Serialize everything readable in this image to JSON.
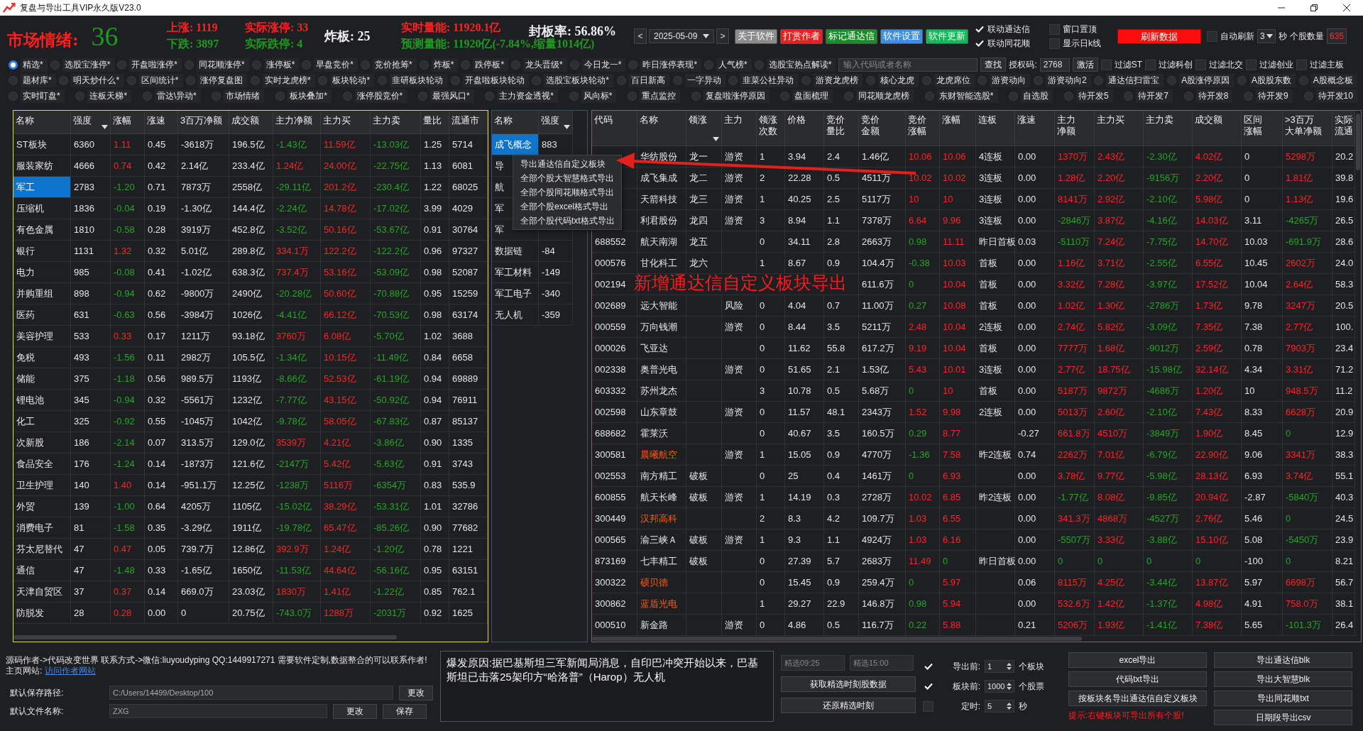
{
  "window": {
    "title": "复盘与导出工具VIP永久版V23.0"
  },
  "mood": {
    "label": "市场情绪:",
    "value": "36"
  },
  "stat_columns": [
    [
      {
        "text": "上涨:  1119",
        "color": "#ff2020"
      },
      {
        "text": "下跌:  3897",
        "color": "#1f9a1f"
      }
    ],
    [
      {
        "text": "实际涨停: 33",
        "color": "#ff2020"
      },
      {
        "text": "实际跌停: 4",
        "color": "#1f9a1f"
      }
    ],
    [
      {
        "text": "炸板:  25",
        "color": "#f0f0f0"
      }
    ],
    [
      {
        "text": "实时量能: 11920.1亿",
        "color": "#ff2020"
      },
      {
        "text": "预测量能: 11920亿(-7.84%,缩量1014亿)",
        "color": "#1f9a1f"
      }
    ],
    [
      {
        "text": "封板率:  56.86%",
        "color": "#f0f0f0"
      }
    ]
  ],
  "date_nav": {
    "prev": "<",
    "date": "2025-05-09",
    "next": ">"
  },
  "top_buttons": [
    {
      "label": "关于软件",
      "color": "#8c8c8c"
    },
    {
      "label": "打赏作者",
      "color": "#e8201e"
    },
    {
      "label": "标记通达信",
      "color": "#1c8c28"
    },
    {
      "label": "软件设置",
      "color": "#3f8fe0"
    },
    {
      "label": "软件更新",
      "color": "#17b85a"
    }
  ],
  "link_options": [
    {
      "label": "联动通达信",
      "checked": true
    },
    {
      "label": "联动同花顺",
      "checked": true
    },
    {
      "label": "窗口置顶",
      "checked": false
    },
    {
      "label": "显示日k线",
      "checked": false
    }
  ],
  "refresh_button": "刷新数据",
  "auto_refresh": {
    "label": "自动刷新",
    "checked": false,
    "interval": "3",
    "unit": "秒"
  },
  "stock_count": {
    "label": "个股数量",
    "value": "635"
  },
  "views": [
    [
      {
        "label": "精选*",
        "selected": true
      },
      {
        "label": "选股宝涨停*",
        "selected": false
      },
      {
        "label": "开盘啦涨停*",
        "selected": false
      },
      {
        "label": "同花顺涨停*",
        "selected": false
      },
      {
        "label": "涨停板*",
        "selected": false
      },
      {
        "label": "早盘竞价*",
        "selected": false
      },
      {
        "label": "竞价抢筹*",
        "selected": false
      },
      {
        "label": "炸板*",
        "selected": false
      },
      {
        "label": "跌停板*",
        "selected": false
      },
      {
        "label": "龙头晋级*",
        "selected": false
      },
      {
        "label": "今日龙一*",
        "selected": false
      },
      {
        "label": "昨日涨停表现*",
        "selected": false
      },
      {
        "label": "人气榜*",
        "selected": false
      },
      {
        "label": "选股宝热点解读*",
        "selected": false
      }
    ],
    [
      {
        "label": "题材库*",
        "selected": false
      },
      {
        "label": "明天炒什么*",
        "selected": false
      },
      {
        "label": "区间统计*",
        "selected": false
      },
      {
        "label": "涨停复盘图",
        "selected": false
      },
      {
        "label": "实时龙虎榜*",
        "selected": false
      },
      {
        "label": "板块轮动*",
        "selected": false
      },
      {
        "label": "韭研板块轮动",
        "selected": false
      },
      {
        "label": "开盘啦板块轮动",
        "selected": false
      },
      {
        "label": "选股宝板块轮动*",
        "selected": false
      },
      {
        "label": "百日新高",
        "selected": false
      },
      {
        "label": "一字异动",
        "selected": false
      },
      {
        "label": "韭菜公社异动",
        "selected": false
      },
      {
        "label": "游资龙虎榜",
        "selected": false
      },
      {
        "label": "核心龙虎",
        "selected": false
      },
      {
        "label": "龙虎席位",
        "selected": false
      },
      {
        "label": "游资动向",
        "selected": false
      },
      {
        "label": "游资动向2",
        "selected": false
      },
      {
        "label": "通达信扫雷宝",
        "selected": false
      },
      {
        "label": "A股涨停原因",
        "selected": false
      },
      {
        "label": "A股股东数",
        "selected": false
      },
      {
        "label": "A股概念板",
        "selected": false
      }
    ],
    [
      {
        "label": "实时盯盘*",
        "selected": false
      },
      {
        "label": "连板天梯*",
        "selected": false
      },
      {
        "label": "雷达\\异动*",
        "selected": false
      },
      {
        "label": "市场情绪",
        "selected": false
      },
      {
        "label": "板块叠加*",
        "selected": false
      },
      {
        "label": "涨停股竞价*",
        "selected": false
      },
      {
        "label": "最强风口*",
        "selected": false
      },
      {
        "label": "主力资金透视*",
        "selected": false
      },
      {
        "label": "风向标*",
        "selected": false
      },
      {
        "label": "重点监控",
        "selected": false
      },
      {
        "label": "复盘啦涨停原因",
        "selected": false
      },
      {
        "label": "盘面梳理",
        "selected": false
      },
      {
        "label": "同花顺龙虎榜",
        "selected": false
      },
      {
        "label": "东财智能选股*",
        "selected": false
      },
      {
        "label": "自选股",
        "selected": false
      },
      {
        "label": "待开发5",
        "selected": false
      },
      {
        "label": "待开发7",
        "selected": false
      },
      {
        "label": "待开发8",
        "selected": false
      },
      {
        "label": "待开发9",
        "selected": false
      },
      {
        "label": "待开发10",
        "selected": false
      }
    ]
  ],
  "search": {
    "placeholder": "输入代码或者名称",
    "button": "查找"
  },
  "auth": {
    "label": "授权码:",
    "value": "2768",
    "button": "激活"
  },
  "filters": [
    {
      "label": "过滤ST",
      "checked": false
    },
    {
      "label": "过滤科创",
      "checked": false
    },
    {
      "label": "过滤北交",
      "checked": false
    },
    {
      "label": "过滤创业",
      "checked": false
    },
    {
      "label": "过滤主板",
      "checked": false
    }
  ],
  "sector_table": {
    "columns": [
      {
        "label": "名称",
        "kind": "plain",
        "sorted": false
      },
      {
        "label": "强度",
        "kind": "plain",
        "sorted": true
      },
      {
        "label": "涨幅",
        "kind": "signed",
        "sorted": false
      },
      {
        "label": "涨速",
        "kind": "plain",
        "sorted": false
      },
      {
        "label": "3百万净额",
        "kind": "plain",
        "sorted": false
      },
      {
        "label": "成交额",
        "kind": "plain",
        "sorted": false
      },
      {
        "label": "主力净额",
        "kind": "signed",
        "sorted": false
      },
      {
        "label": "主力买",
        "kind": "signed",
        "sorted": false
      },
      {
        "label": "主力卖",
        "kind": "signed",
        "sorted": false
      },
      {
        "label": "量比",
        "kind": "plain",
        "sorted": false
      },
      {
        "label": "流通市",
        "kind": "plain",
        "sorted": false
      }
    ],
    "rows": [
      {
        "cells": [
          "ST板块",
          "6360",
          "1.11",
          "0.45",
          "-3618万",
          "196.5亿",
          "-1.43亿",
          "11.59亿",
          "-13.03亿",
          "1.25",
          "5714"
        ],
        "selected": false
      },
      {
        "cells": [
          "服装家纺",
          "4666",
          "0.74",
          "0.42",
          "2.14亿",
          "233.4亿",
          "1.24亿",
          "24.00亿",
          "-22.75亿",
          "1.13",
          "6081"
        ],
        "selected": false
      },
      {
        "cells": [
          "军工",
          "2783",
          "-1.20",
          "0.71",
          "7873万",
          "2558亿",
          "-29.11亿",
          "201.2亿",
          "-230.4亿",
          "1.22",
          "68025"
        ],
        "selected": true
      },
      {
        "cells": [
          "压缩机",
          "1836",
          "-0.04",
          "0.19",
          "-1.30亿",
          "144.4亿",
          "-2.24亿",
          "14.78亿",
          "-17.02亿",
          "3.99",
          "4029"
        ],
        "selected": false
      },
      {
        "cells": [
          "有色金属",
          "1810",
          "-0.58",
          "0.28",
          "3919万",
          "452.8亿",
          "-3.52亿",
          "50.16亿",
          "-53.67亿",
          "0.91",
          "30764"
        ],
        "selected": false
      },
      {
        "cells": [
          "银行",
          "1131",
          "1.32",
          "0.32",
          "5.01亿",
          "289.8亿",
          "334.1万",
          "122.2亿",
          "-122.2亿",
          "0.96",
          "97327"
        ],
        "selected": false
      },
      {
        "cells": [
          "电力",
          "985",
          "-0.08",
          "0.41",
          "-1.02亿",
          "638.3亿",
          "737.4万",
          "53.16亿",
          "-53.09亿",
          "0.98",
          "52087"
        ],
        "selected": false
      },
      {
        "cells": [
          "并购重组",
          "898",
          "-0.94",
          "0.62",
          "-9800万",
          "2490亿",
          "-20.28亿",
          "50.60亿",
          "-70.88亿",
          "0.95",
          "15259"
        ],
        "selected": false
      },
      {
        "cells": [
          "医药",
          "631",
          "-0.63",
          "0.56",
          "-3984万",
          "1026亿",
          "-4.41亿",
          "66.12亿",
          "-70.53亿",
          "0.98",
          "63174"
        ],
        "selected": false
      },
      {
        "cells": [
          "美容护理",
          "533",
          "0.33",
          "0.17",
          "1211万",
          "93.18亿",
          "3760万",
          "6.08亿",
          "-5.70亿",
          "1.02",
          "3688"
        ],
        "selected": false
      },
      {
        "cells": [
          "免税",
          "493",
          "-1.56",
          "0.11",
          "2982万",
          "105.5亿",
          "-1.34亿",
          "10.15亿",
          "-11.49亿",
          "0.84",
          "6658"
        ],
        "selected": false
      },
      {
        "cells": [
          "储能",
          "375",
          "-1.18",
          "0.56",
          "989.5万",
          "1193亿",
          "-8.66亿",
          "52.53亿",
          "-61.19亿",
          "0.94",
          "69889"
        ],
        "selected": false
      },
      {
        "cells": [
          "锂电池",
          "345",
          "-0.94",
          "0.32",
          "-5561万",
          "1232亿",
          "-7.77亿",
          "43.15亿",
          "-50.92亿",
          "0.94",
          "76911"
        ],
        "selected": false
      },
      {
        "cells": [
          "化工",
          "325",
          "-0.92",
          "0.55",
          "-1045万",
          "1042亿",
          "-9.78亿",
          "58.05亿",
          "-67.83亿",
          "0.87",
          "85137"
        ],
        "selected": false
      },
      {
        "cells": [
          "次新股",
          "186",
          "-2.14",
          "0.07",
          "313.5万",
          "129.0亿",
          "3539万",
          "4.21亿",
          "-3.86亿",
          "0.90",
          "1335"
        ],
        "selected": false
      },
      {
        "cells": [
          "食品安全",
          "176",
          "-1.24",
          "0.14",
          "-1873万",
          "121.6亿",
          "-2147万",
          "5.42亿",
          "-5.63亿",
          "0.91",
          "3743"
        ],
        "selected": false
      },
      {
        "cells": [
          "卫生护理",
          "140",
          "1.40",
          "0.14",
          "-951.1万",
          "12.25亿",
          "-1238万",
          "5116万",
          "-6354万",
          "0.83",
          "535.9"
        ],
        "selected": false
      },
      {
        "cells": [
          "外贸",
          "139",
          "-1.00",
          "0.64",
          "4205万",
          "1105亿",
          "-15.02亿",
          "38.29亿",
          "-53.31亿",
          "1.01",
          "32786"
        ],
        "selected": false
      },
      {
        "cells": [
          "消费电子",
          "81",
          "-1.58",
          "0.35",
          "-3.29亿",
          "1911亿",
          "-19.78亿",
          "65.47亿",
          "-85.26亿",
          "0.90",
          "77682"
        ],
        "selected": false
      },
      {
        "cells": [
          "芬太尼替代",
          "47",
          "0.47",
          "0.05",
          "739.7万",
          "12.86亿",
          "392.9万",
          "1.24亿",
          "-1.20亿",
          "0.78",
          "1221"
        ],
        "selected": false
      },
      {
        "cells": [
          "通信",
          "47",
          "-1.48",
          "0.33",
          "-1.65亿",
          "1650亿",
          "-11.53亿",
          "44.64亿",
          "-56.16亿",
          "0.95",
          "63151"
        ],
        "selected": false
      },
      {
        "cells": [
          "天津自贸区",
          "37",
          "0.37",
          "0.14",
          "669.0万",
          "23.03亿",
          "1830万",
          "1.41亿",
          "-1.22亿",
          "0.85",
          "762.1"
        ],
        "selected": false
      },
      {
        "cells": [
          "防脱发",
          "28",
          "0.28",
          "0.00",
          "0",
          "20.75亿",
          "-743.0万",
          "1288万",
          "-2031万",
          "0.92",
          "1625"
        ],
        "selected": false
      }
    ]
  },
  "concept_table": {
    "columns": [
      {
        "label": "名称",
        "sorted": false
      },
      {
        "label": "强度",
        "sorted": true
      }
    ],
    "rows": [
      {
        "cells": [
          "成飞概念",
          "883"
        ],
        "selected": true
      },
      {
        "cells": [
          "导",
          null
        ],
        "selected": false
      },
      {
        "cells": [
          "航",
          null
        ],
        "selected": false
      },
      {
        "cells": [
          "军",
          null
        ],
        "selected": false
      },
      {
        "cells": [
          "军",
          null
        ],
        "selected": false
      },
      {
        "cells": [
          "数据链",
          "-84"
        ],
        "selected": false
      },
      {
        "cells": [
          "军工材料",
          "-149"
        ],
        "selected": false
      },
      {
        "cells": [
          "军工电子",
          "-340"
        ],
        "selected": false
      },
      {
        "cells": [
          "无人机",
          "-359"
        ],
        "selected": false
      }
    ]
  },
  "context_menu": {
    "items": [
      "导出通达信自定义板块",
      "全部个股大智慧格式导出",
      "全部个股同花顺格式导出",
      "全部个股excel格式导出",
      "全部个股代码txt格式导出"
    ]
  },
  "stock_table": {
    "columns": [
      {
        "lines": [
          "代码"
        ],
        "kind": "plain",
        "sorted": false
      },
      {
        "lines": [
          "名称"
        ],
        "kind": "name",
        "sorted": false
      },
      {
        "lines": [
          "领涨"
        ],
        "kind": "plain",
        "sorted": true
      },
      {
        "lines": [
          "主力"
        ],
        "kind": "plain",
        "sorted": false
      },
      {
        "lines": [
          "领涨",
          "次数"
        ],
        "kind": "plain",
        "sorted": false
      },
      {
        "lines": [
          "价格"
        ],
        "kind": "plain",
        "sorted": false
      },
      {
        "lines": [
          "竞价",
          "量比"
        ],
        "kind": "plain",
        "sorted": false
      },
      {
        "lines": [
          "竞价",
          "金额"
        ],
        "kind": "plain",
        "sorted": false
      },
      {
        "lines": [
          "竞价",
          "涨幅"
        ],
        "kind": "auction",
        "sorted": false
      },
      {
        "lines": [
          "涨幅"
        ],
        "kind": "signed",
        "sorted": false
      },
      {
        "lines": [
          "连板"
        ],
        "kind": "plain",
        "sorted": false
      },
      {
        "lines": [
          "涨速"
        ],
        "kind": "plain",
        "sorted": false
      },
      {
        "lines": [
          "主力",
          "净额"
        ],
        "kind": "signed",
        "sorted": false
      },
      {
        "lines": [
          "主力买"
        ],
        "kind": "signed",
        "sorted": false
      },
      {
        "lines": [
          "主力卖"
        ],
        "kind": "signed",
        "sorted": false
      },
      {
        "lines": [
          "成交额"
        ],
        "kind": "signed",
        "sorted": false
      },
      {
        "lines": [
          "区间",
          "涨幅"
        ],
        "kind": "plain",
        "sorted": false
      },
      {
        "lines": [
          ">3百万",
          "大单净额"
        ],
        "kind": "signed",
        "sorted": false
      },
      {
        "lines": [
          "实际",
          "流通"
        ],
        "kind": "plain",
        "sorted": false
      }
    ],
    "rows": [
      {
        "cells": [
          null,
          "华纺股份",
          "龙一",
          "游资",
          "1",
          "3.94",
          "2.4",
          "1.46亿",
          "10.06",
          "10.06",
          "4连板",
          "0.00",
          "1370万",
          "2.43亿",
          "-2.30亿",
          "4.02亿",
          "0",
          "5298万",
          "20.2"
        ],
        "highlight": false
      },
      {
        "cells": [
          null,
          "成飞集成",
          "龙二",
          "游资",
          "2",
          "22.28",
          "0.5",
          "4511万",
          "10.02",
          "10.02",
          "3连板",
          "0.00",
          "1.28亿",
          "2.20亿",
          "-9156万",
          "2.20亿",
          "0",
          "1.81亿",
          "39.8"
        ],
        "highlight": false
      },
      {
        "cells": [
          null,
          "天箭科技",
          "龙三",
          "游资",
          "1",
          "40.25",
          "2.5",
          "5117万",
          "10",
          "10",
          "3连板",
          "0.00",
          "8141万",
          "2.92亿",
          "-2.10亿",
          "5.98亿",
          "0",
          "1.13亿",
          "19.6"
        ],
        "highlight": false
      },
      {
        "cells": [
          null,
          "利君股份",
          "龙四",
          "游资",
          "3",
          "8.94",
          "1.1",
          "7378万",
          "6.64",
          "9.96",
          "3连板",
          "0.00",
          "-2846万",
          "3.87亿",
          "-4.16亿",
          "14.03亿",
          "3.11",
          "-4265万",
          "26.5"
        ],
        "highlight": false
      },
      {
        "cells": [
          "688552",
          "航天南湖",
          "龙五",
          null,
          "0",
          "34.11",
          "2.8",
          "2663万",
          "0.98",
          "11.11",
          "昨日首板",
          "0.03",
          "-5110万",
          "7.24亿",
          "-7.75亿",
          "14.70亿",
          "10.03",
          "-691.9万",
          "28.6"
        ],
        "highlight": false
      },
      {
        "cells": [
          "000576",
          "甘化科工",
          "龙六",
          null,
          "1",
          "8.67",
          "0.9",
          "104.4万",
          "-0.38",
          "10.03",
          "首板",
          "0.00",
          "1.16亿",
          "3.71亿",
          "-2.55亿",
          "6.55亿",
          "10.45",
          "2602万",
          "24.0"
        ],
        "highlight": false
      },
      {
        "cells": [
          "002194",
          null,
          null,
          null,
          null,
          null,
          null,
          "611.6万",
          "0",
          "10.04",
          "首板",
          "0.00",
          "3.32亿",
          "7.28亿",
          "-3.97亿",
          "17.52亿",
          "10.04",
          "2.64亿",
          "58.3"
        ]
      },
      {
        "cells": [
          "002689",
          "远大智能",
          null,
          "风险",
          "0",
          "4.04",
          "0.7",
          "11.00万",
          "0.27",
          "10.08",
          "首板",
          "0.00",
          "1.02亿",
          "1.30亿",
          "-2786万",
          "1.73亿",
          "9.78",
          "3247万",
          "20.5"
        ],
        "highlight": false
      },
      {
        "cells": [
          "000559",
          "万向钱潮",
          null,
          "游资",
          "0",
          "8.44",
          "3.5",
          "5211万",
          "2.48",
          "10.04",
          "2连板",
          "0.00",
          "2.74亿",
          "5.82亿",
          "-3.09亿",
          "7.35亿",
          "7.38",
          "2.77亿",
          "100."
        ],
        "highlight": false
      },
      {
        "cells": [
          "000026",
          "飞亚达",
          null,
          null,
          "0",
          "11.62",
          "55.8",
          "617.2万",
          "9.19",
          "10.04",
          "首板",
          "0.00",
          "7777万",
          "1.68亿",
          "-9012万",
          "2.59亿",
          "0.78",
          "7903万",
          "23.4"
        ],
        "highlight": false
      },
      {
        "cells": [
          "002338",
          "奥普光电",
          null,
          "游资",
          "0",
          "51.65",
          "2.1",
          "1.53亿",
          "5.43",
          "10.01",
          "3连板",
          "0.00",
          "2.77亿",
          "18.75亿",
          "-15.98亿",
          "32.14亿",
          "4.34",
          "3.31亿",
          "71.2"
        ],
        "highlight": false
      },
      {
        "cells": [
          "603332",
          "苏州龙杰",
          null,
          null,
          "3",
          "10.78",
          "0.5",
          "5.68万",
          "0",
          "10",
          "首板",
          "0.00",
          "5187万",
          "9872万",
          "-4686万",
          "1.20亿",
          "10",
          "948.5万",
          "11.2"
        ],
        "highlight": false
      },
      {
        "cells": [
          "002598",
          "山东章鼓",
          null,
          "游资",
          "0",
          "11.57",
          "48.1",
          "2343万",
          "1.52",
          "9.98",
          "2连板",
          "0.00",
          "5013万",
          "2.60亿",
          "-2.10亿",
          "7.43亿",
          "8.33",
          "6628万",
          "20.9"
        ],
        "highlight": false
      },
      {
        "cells": [
          "688682",
          "霍莱沃",
          null,
          null,
          "0",
          "40.67",
          "3.5",
          "160.5万",
          "0.29",
          "8.77",
          null,
          "-0.27",
          "661.8万",
          "4510万",
          "-3849万",
          "1.90亿",
          "8.45",
          "0",
          "12.9"
        ],
        "highlight": false
      },
      {
        "cells": [
          "300581",
          "晨曦航空",
          null,
          "游资",
          "1",
          "15.05",
          "0.9",
          "4770万",
          "-1.36",
          "7.58",
          "昨2连板",
          "0.74",
          "2262万",
          "7.01亿",
          "-6.79亿",
          "22.90亿",
          "9.06",
          "3341万",
          "38.3"
        ],
        "highlight": true
      },
      {
        "cells": [
          "002553",
          "南方精工",
          "破板",
          null,
          "0",
          "25",
          "0.4",
          "1461万",
          "0",
          "6.93",
          null,
          "0.00",
          "3.78亿",
          "9.77亿",
          "-5.98亿",
          "28.13亿",
          "6.93",
          "3.74亿",
          "55.1"
        ],
        "highlight": false
      },
      {
        "cells": [
          "600855",
          "航天长峰",
          "破板",
          "游资",
          "1",
          "14.19",
          "0.3",
          "2728万",
          "10.02",
          "6.85",
          "昨2连板",
          "0.00",
          "-1.77亿",
          "8.08亿",
          "-9.85亿",
          "20.94亿",
          "-2.87",
          "-5840万",
          "40.3"
        ],
        "highlight": false
      },
      {
        "cells": [
          "300449",
          "汉邦高科",
          null,
          null,
          "2",
          "8.3",
          "4.2",
          "109.7万",
          "1.03",
          "6.55",
          null,
          "0.00",
          "341.3万",
          "4868万",
          "-4527万",
          "2.76亿",
          "5.46",
          "0",
          "24.5"
        ],
        "highlight": true
      },
      {
        "cells": [
          "000565",
          "渝三峡Ａ",
          "破板",
          "游资",
          "1",
          "9.3",
          "1.1",
          "4924万",
          "1.03",
          "6.16",
          null,
          "0.00",
          "-5507万",
          "3.33亿",
          "-3.88亿",
          "15.10亿",
          "5.08",
          "-5450万",
          "23.9"
        ],
        "highlight": false
      },
      {
        "cells": [
          "873169",
          "七丰精工",
          "破板",
          null,
          "0",
          "27.39",
          "5.7",
          "2683万",
          "11.49",
          "0",
          "昨日首板",
          "0.00",
          "0",
          "0",
          "0",
          "0",
          "-100",
          "0",
          "8.21"
        ],
        "highlight": false
      },
      {
        "cells": [
          "300322",
          "硕贝德",
          null,
          null,
          "0",
          "15.45",
          "0.9",
          "259.4万",
          "0",
          "5.97",
          null,
          "0.06",
          "8115万",
          "4.25亿",
          "-3.44亿",
          "13.87亿",
          "5.97",
          "6698万",
          "56.7"
        ],
        "highlight": true
      },
      {
        "cells": [
          "300862",
          "蓝盾光电",
          null,
          null,
          "1",
          "29.27",
          "22.9",
          "146.8万",
          "0.98",
          "5.94",
          null,
          "0.00",
          "532.6万",
          "1.42亿",
          "-1.37亿",
          "4.98亿",
          "4.91",
          "758.0万",
          "38.1"
        ],
        "highlight": true
      },
      {
        "cells": [
          "000510",
          "新金路",
          null,
          "游资",
          "0",
          "4.86",
          "0.5",
          "116.7万",
          "0.22",
          "5.88",
          null,
          "0.21",
          "5206万",
          "1.93亿",
          "-1.41亿",
          "7.38亿",
          "5.65",
          "-101.3万",
          "26.4"
        ],
        "highlight": false
      }
    ]
  },
  "annotation": {
    "text": "新增通达信自定义板块导出"
  },
  "author_note": {
    "text": "源码作者->代码改变世界 联系方式->微信:liuyoudyping QQ:1449917271 需要软件定制,数据整合的可以联系作者! 主页网站:",
    "link": "访问作者网站"
  },
  "save_path": {
    "label": "默认保存路径:",
    "value": "C:/Users/14499/Desktop/100",
    "button": "更改"
  },
  "file_name": {
    "label": "默认文件名称:",
    "value": "ZXG",
    "buttons": [
      "更改",
      "保存"
    ]
  },
  "news": "爆发原因:据巴基斯坦三军新闻局消息，自印巴冲突开始以来，巴基斯坦已击落25架印方“哈洛普”（Harop）无人机",
  "snapshot": {
    "fields": [
      {
        "placeholder": "精选09:25"
      },
      {
        "placeholder": "精选15:00"
      }
    ],
    "buttons": [
      "获取精选时刻股数据",
      "还原精选时刻"
    ]
  },
  "export_options": [
    {
      "label": "导出前:",
      "checked": true,
      "value": "1",
      "unit": "个板块"
    },
    {
      "label": "板块前:",
      "checked": true,
      "value": "1000",
      "unit": "个股票"
    },
    {
      "label": "定时:",
      "checked": false,
      "value": "5",
      "unit": "秒"
    }
  ],
  "export_buttons": [
    [
      "excel导出",
      "代码txt导出",
      "按板块名导出通达信自定义板块"
    ],
    [
      "导出通达信blk",
      "导出大智慧blk",
      "导出同花顺txt",
      "日期段导出csv"
    ]
  ],
  "hint": "提示:右键板块可导出所有个股!"
}
